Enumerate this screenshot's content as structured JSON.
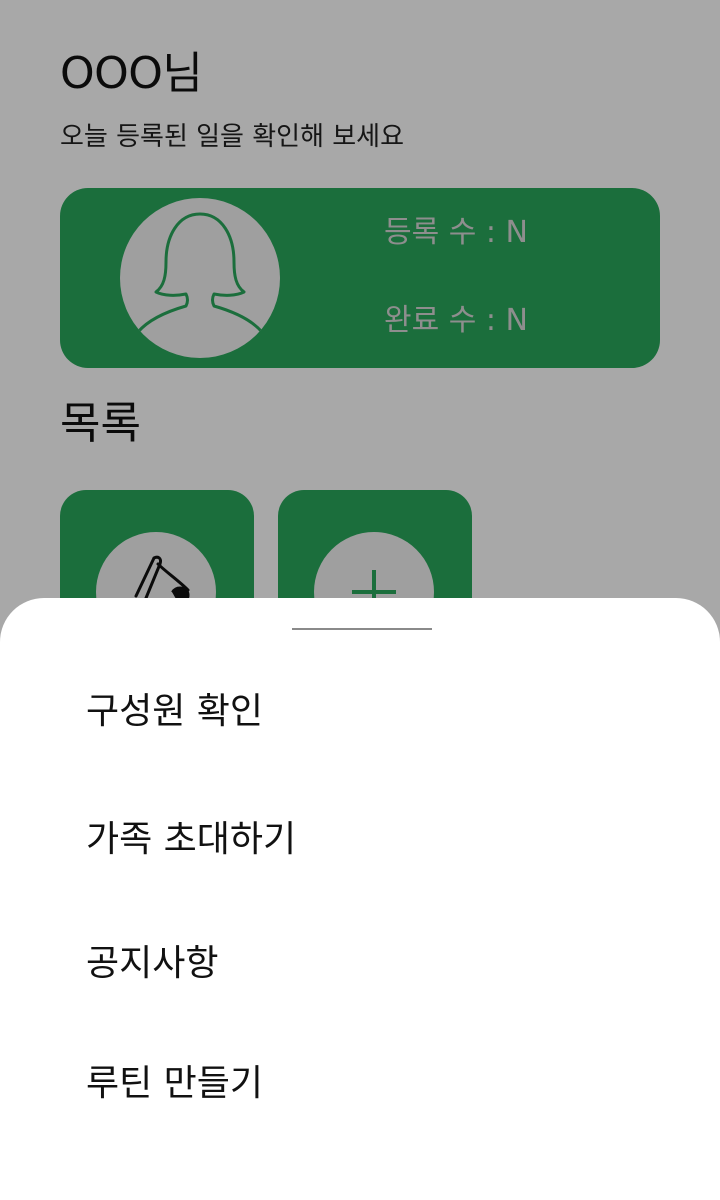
{
  "header": {
    "greeting": "OOO님",
    "subtitle": "오늘 등록된 일을 확인해 보세요"
  },
  "profile_card": {
    "registered_label": "등록 수 : N",
    "completed_label": "완료 수 : N",
    "avatar_icon": "person-silhouette-icon"
  },
  "list_section": {
    "title": "목록",
    "tiles": [
      {
        "icon": "broom-icon"
      },
      {
        "icon": "plus-icon"
      }
    ]
  },
  "bottom_sheet": {
    "menu": [
      {
        "label": "구성원 확인"
      },
      {
        "label": "가족 초대하기"
      },
      {
        "label": "공지사항"
      },
      {
        "label": "루틴 만들기"
      }
    ]
  },
  "colors": {
    "brand_green": "#2aa85c",
    "scrim": "rgba(0,0,0,0.34)"
  }
}
